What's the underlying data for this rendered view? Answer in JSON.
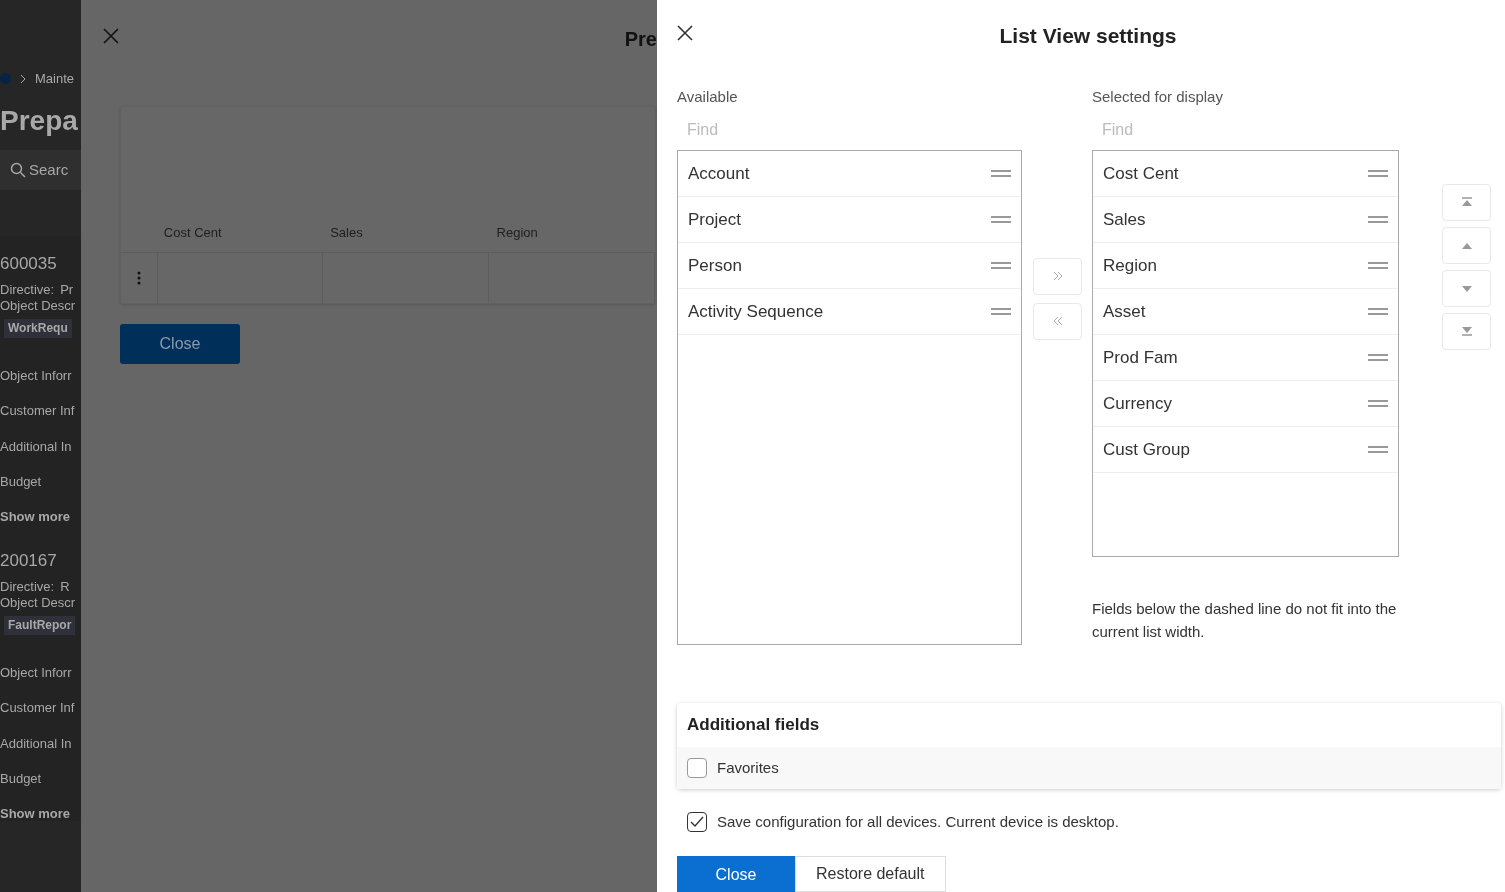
{
  "background_page": {
    "breadcrumb": "Mainte",
    "title": "Prepa",
    "search_placeholder": "Searc",
    "cards": [
      {
        "number": "600035",
        "directive_label": "Directive:",
        "directive_value": "Pr",
        "object_label": "Object Descr",
        "tag": "WorkRequ",
        "sections": [
          "Object Inforr",
          "Customer Inf",
          "Additional In",
          "Budget"
        ],
        "show_more": "Show more"
      },
      {
        "number": "200167",
        "directive_label": "Directive:",
        "directive_value": "R",
        "object_label": "Object Descr",
        "tag": "FaultRepor",
        "sections": [
          "Object Inforr",
          "Customer Inf",
          "Additional In",
          "Budget"
        ],
        "show_more": "Show more"
      }
    ]
  },
  "background_dialog": {
    "title": "Pre",
    "columns": [
      "Cost Cent",
      "Sales",
      "Region"
    ],
    "close_button": "Close"
  },
  "dialog": {
    "title": "List View settings",
    "available": {
      "label": "Available",
      "find_placeholder": "Find",
      "items": [
        "Account",
        "Project",
        "Person",
        "Activity Sequence"
      ]
    },
    "selected": {
      "label": "Selected for display",
      "find_placeholder": "Find",
      "items": [
        "Cost Cent",
        "Sales",
        "Region",
        "Asset",
        "Prod Fam",
        "Currency",
        "Cust Group"
      ]
    },
    "note": "Fields below the dashed line do not fit into the current list width.",
    "additional_fields": {
      "title": "Additional fields",
      "options": [
        {
          "label": "Favorites",
          "checked": false
        }
      ]
    },
    "save_all_devices": {
      "label": "Save configuration for all devices. Current device is desktop.",
      "checked": true
    },
    "buttons": [
      {
        "label": "Close",
        "kind": "primary"
      },
      {
        "label": "Restore default",
        "kind": "secondary"
      }
    ]
  }
}
